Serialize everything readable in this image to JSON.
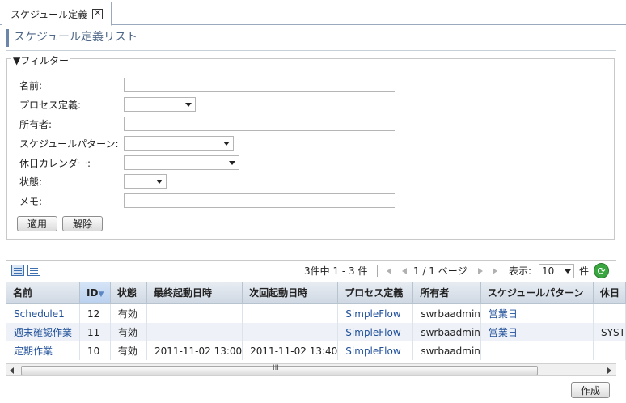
{
  "tab": {
    "label": "スケジュール定義",
    "close": "✕"
  },
  "page_title": "スケジュール定義リスト",
  "filter": {
    "legend": "▼フィルター",
    "fields": [
      {
        "label": "名前:",
        "value": ""
      },
      {
        "label": "プロセス定義:",
        "value": ""
      },
      {
        "label": "所有者:",
        "value": ""
      },
      {
        "label": "スケジュールパターン:",
        "value": ""
      },
      {
        "label": "休日カレンダー:",
        "value": ""
      },
      {
        "label": "状態:",
        "value": ""
      },
      {
        "label": "メモ:",
        "value": ""
      }
    ],
    "apply_label": "適用",
    "clear_label": "解除"
  },
  "pager": {
    "summary": "3件中 1 - 3 件",
    "page_text": "1 / 1 ページ",
    "display_label": "表示:",
    "page_size": "10",
    "unit": "件"
  },
  "table": {
    "columns": [
      "名前",
      "ID",
      "状態",
      "最終起動日時",
      "次回起動日時",
      "プロセス定義",
      "所有者",
      "スケジュールパターン",
      "休日"
    ],
    "sorted_column": "ID",
    "rows": [
      {
        "name": "Schedule1",
        "id": "12",
        "status": "有効",
        "last_run": "",
        "next_run": "",
        "process": "SimpleFlow",
        "owner": "swrbaadmin",
        "pattern": "営業日",
        "holiday": ""
      },
      {
        "name": "週末確認作業",
        "id": "11",
        "status": "有効",
        "last_run": "",
        "next_run": "",
        "process": "SimpleFlow",
        "owner": "swrbaadmin",
        "pattern": "営業日",
        "holiday": "SYST"
      },
      {
        "name": "定期作業",
        "id": "10",
        "status": "有効",
        "last_run": "2011-11-02 13:00",
        "next_run": "2011-11-02 13:40",
        "process": "SimpleFlow",
        "owner": "swrbaadmin",
        "pattern": "",
        "holiday": ""
      }
    ]
  },
  "scrollbar_grip": "III",
  "create_label": "作成",
  "colors": {
    "link": "#1f4f99",
    "title": "#4e6787",
    "header_bg": "#cfd8e3",
    "alt_row": "#eef2f8"
  }
}
